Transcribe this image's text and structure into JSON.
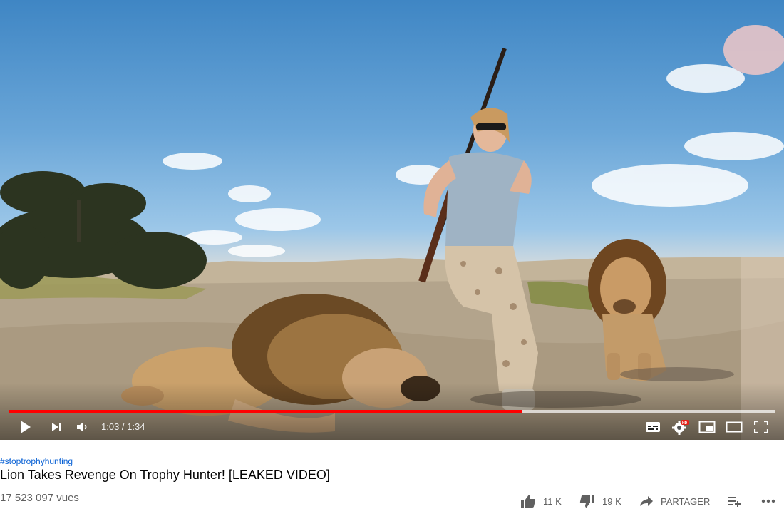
{
  "video": {
    "time_current": "1:03",
    "time_total": "1:34",
    "time_display": "1:03 / 1:34",
    "progress_played": 0.67,
    "progress_loaded": 1.0,
    "hd_badge": "HD",
    "accent_color": "#ff0000"
  },
  "info": {
    "hashtag": "#stoptrophyhunting",
    "title": "Lion Takes Revenge On Trophy Hunter! [LEAKED VIDEO]",
    "views": "17 523 097 vues"
  },
  "actions": {
    "like_count": "11 K",
    "dislike_count": "19 K",
    "share_label": "PARTAGER",
    "icons": [
      "thumb-up-icon",
      "thumb-down-icon",
      "share-icon",
      "add-to-playlist-icon",
      "more-icon"
    ]
  }
}
